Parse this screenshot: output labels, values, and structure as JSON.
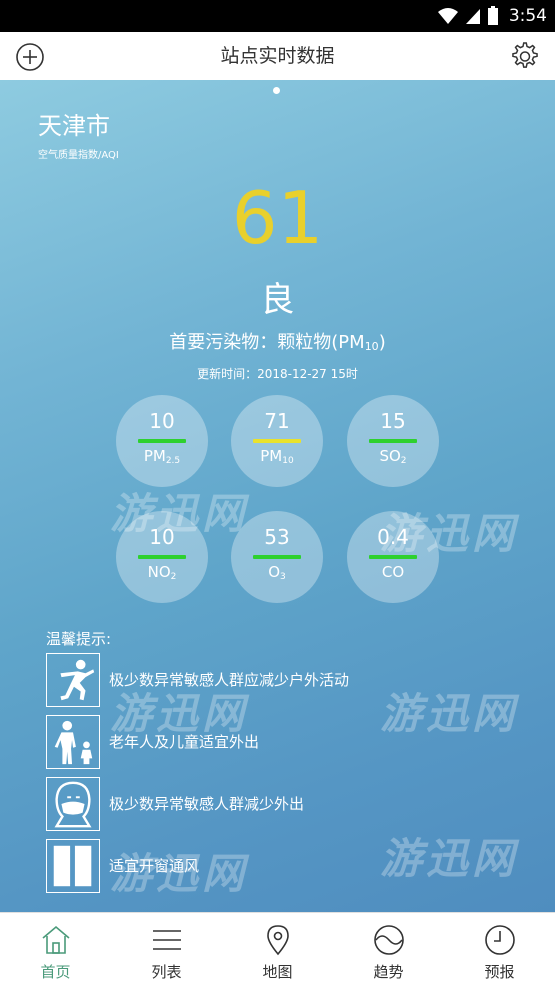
{
  "status_bar": {
    "time": "3:54"
  },
  "header": {
    "title": "站点实时数据"
  },
  "main": {
    "city": "天津市",
    "aqi_caption": "空气质量指数/AQI",
    "aqi_value": "61",
    "aqi_level": "良",
    "primary_label": "首要污染物：颗粒物(PM",
    "primary_sub": "10",
    "primary_close": ")",
    "update_time": "更新时间：2018-12-27 15时"
  },
  "pollutants": [
    {
      "value": "10",
      "name": "PM",
      "sub": "2.5",
      "color": "#2ed12e"
    },
    {
      "value": "71",
      "name": "PM",
      "sub": "10",
      "color": "#e9e22c"
    },
    {
      "value": "15",
      "name": "SO",
      "sub": "2",
      "color": "#2ed12e"
    },
    {
      "value": "10",
      "name": "NO",
      "sub": "2",
      "color": "#2ed12e"
    },
    {
      "value": "53",
      "name": "O",
      "sub": "3",
      "color": "#2ed12e"
    },
    {
      "value": "0.4",
      "name": "CO",
      "sub": "",
      "color": "#2ed12e"
    }
  ],
  "tips": {
    "title": "温馨提示:",
    "items": [
      {
        "text": "极少数异常敏感人群应减少户外活动",
        "icon": "running-person-icon"
      },
      {
        "text": "老年人及儿童适宜外出",
        "icon": "elder-child-icon"
      },
      {
        "text": "极少数异常敏感人群减少外出",
        "icon": "mask-face-icon"
      },
      {
        "text": "适宜开窗通风",
        "icon": "window-icon"
      }
    ]
  },
  "watermark": "游迅网",
  "nav": [
    {
      "label": "首页",
      "icon": "home-icon"
    },
    {
      "label": "列表",
      "icon": "list-icon"
    },
    {
      "label": "地图",
      "icon": "map-pin-icon"
    },
    {
      "label": "趋势",
      "icon": "trend-icon"
    },
    {
      "label": "预报",
      "icon": "clock-icon"
    }
  ],
  "colors": {
    "aqi": "#e9d02c",
    "good": "#2ed12e",
    "moderate": "#e9e22c",
    "nav_active": "#4a9a7a"
  }
}
